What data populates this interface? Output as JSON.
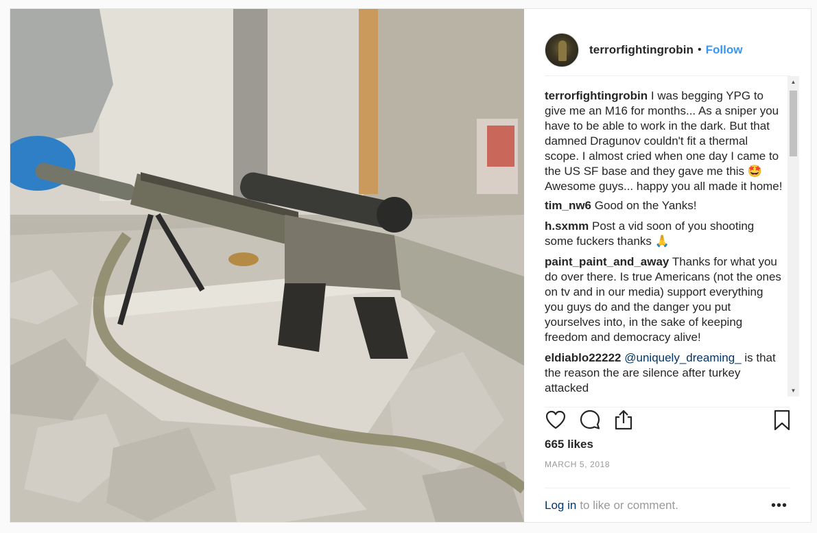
{
  "post": {
    "username": "terrorfightingrobin",
    "follow_label": "Follow",
    "separator": "•",
    "comments": [
      {
        "user": "terrorfightingrobin",
        "text": "I was begging YPG to give me an M16 for months... As a sniper you have to be able to work in the dark. But that damned Dragunov couldn't fit a thermal scope. I almost cried when one day I came to the US SF base and they gave me this 🤩 Awesome guys... happy you all made it home!"
      },
      {
        "user": "tim_nw6",
        "text": "Good on the Yanks!"
      },
      {
        "user": "h.sxmm",
        "text": "Post a vid soon of you shooting some fuckers thanks 🙏"
      },
      {
        "user": "paint_paint_and_away",
        "text": "Thanks for what you do over there. Is true Americans (not the ones on tv and in our media) support everything you guys do and the danger you put yourselves into, in the sake of keeping freedom and democracy alive!"
      },
      {
        "user": "eldiablo22222",
        "mention": "@uniquely_dreaming_",
        "text": "is that the reason the are silence after turkey attacked"
      }
    ],
    "likes": "665 likes",
    "date": "March 5, 2018",
    "login_link": "Log in",
    "login_text": "to like or comment.",
    "more_label": "•••"
  },
  "icons": {
    "like": "heart-icon",
    "comment": "comment-bubble-icon",
    "share": "share-icon",
    "save": "bookmark-icon",
    "more": "more-options-icon"
  },
  "colors": {
    "accent": "#3897f0",
    "link": "#003569",
    "muted": "#999999",
    "text": "#262626"
  }
}
